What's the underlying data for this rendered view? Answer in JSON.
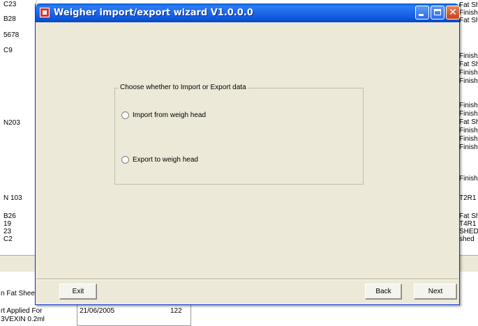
{
  "background": {
    "left_cells": [
      "C23",
      "B28",
      "5678",
      "C9",
      "N203",
      "N 103",
      "B26",
      "19",
      "23",
      "C2"
    ],
    "right_cells": [
      "Fat Sh",
      "Finishir",
      "Fat Sh",
      "Finishir",
      "Fat Sh",
      "Finishir",
      "Finishir",
      "Finishir",
      "Finishir",
      "Fat Sh",
      "Finishir",
      "Finishir",
      "Finishir",
      "Finishir",
      "T2R1",
      "Fat Sh",
      "T4R1",
      "SHED",
      "shed"
    ],
    "bottom_cells": [
      "n Fat Shee",
      "rt Applied For",
      "3VEXIN 0.2ml",
      "21/06/2005",
      "122"
    ]
  },
  "window": {
    "title": "Weigher import/export wizard V1.0.0.0",
    "group_label": "Choose whether to Import or Export data",
    "options": [
      "Import from weigh head",
      "Export to weigh head"
    ],
    "buttons": {
      "exit": "Exit",
      "back": "Back",
      "next": "Next"
    }
  },
  "icons": {
    "app": "app-icon",
    "minimize": "minimize-icon",
    "maximize": "maximize-icon",
    "close": "close-icon"
  },
  "colors": {
    "titlebar": "#0a5bd9",
    "dialog_bg": "#ece9d8",
    "close_button": "#c9401b"
  }
}
